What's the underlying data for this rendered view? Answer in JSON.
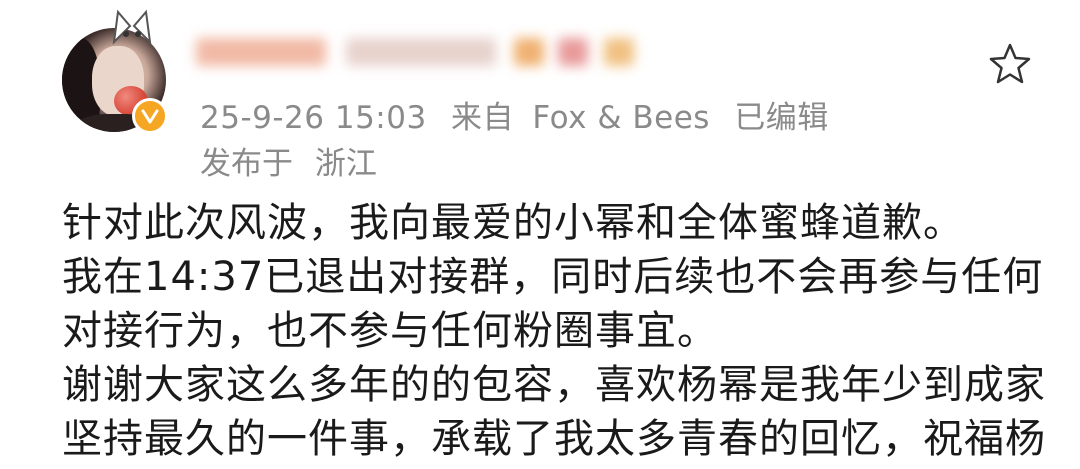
{
  "post": {
    "timestamp": "25-9-26 15:03",
    "source_prefix": "来自",
    "source_app": "Fox & Bees",
    "edited_label": "已编辑",
    "location_prefix": "发布于",
    "location": "浙江",
    "body_lines": [
      "针对此次风波，我向最爱的小幂和全体蜜蜂道歉。",
      "我在14:37已退出对接群，同时后续也不会再参与任何",
      "对接行为，也不参与任何粉圈事宜。",
      "谢谢大家这么多年的的包容，喜欢杨幂是我年少到成家",
      "坚持最久的一件事，承载了我太多青春的回忆，祝福杨"
    ]
  },
  "icons": {
    "star": "star-outline-icon",
    "verified": "verified-badge-icon",
    "avatar_decoration": "cat-ears-decoration-icon"
  },
  "colors": {
    "meta_text": "#8a8a8a",
    "body_text": "#1a1a1a",
    "verified_badge": "#f5a623",
    "background": "#ffffff"
  }
}
